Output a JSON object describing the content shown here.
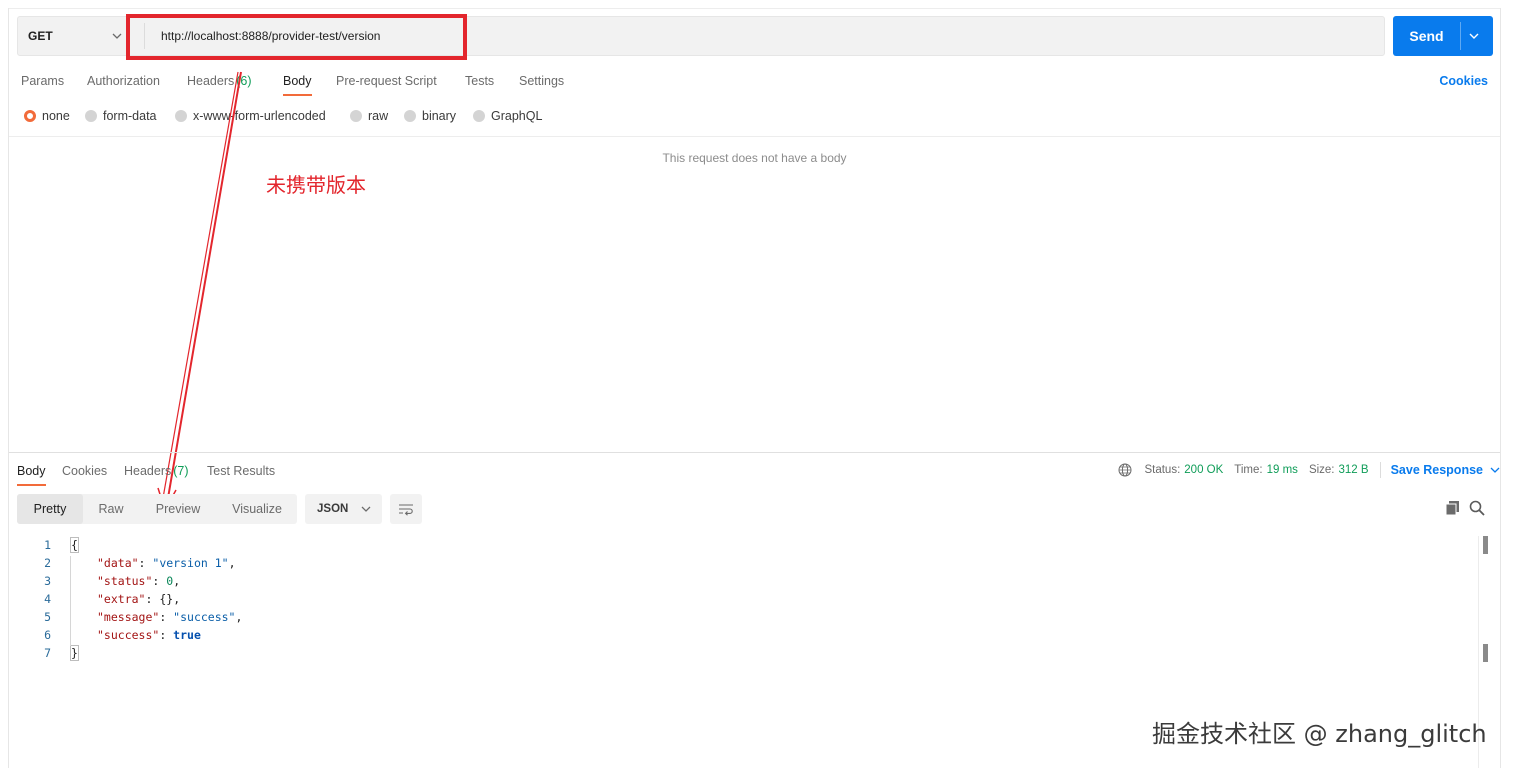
{
  "request": {
    "method": "GET",
    "url": "http://localhost:8888/provider-test/version",
    "send_label": "Send"
  },
  "request_tabs": [
    {
      "label": "Params"
    },
    {
      "label": "Authorization"
    },
    {
      "label": "Headers",
      "count": "(6)"
    },
    {
      "label": "Body",
      "active": true
    },
    {
      "label": "Pre-request Script"
    },
    {
      "label": "Tests"
    },
    {
      "label": "Settings"
    }
  ],
  "cookies_label": "Cookies",
  "body_types": [
    {
      "label": "none",
      "selected": true
    },
    {
      "label": "form-data"
    },
    {
      "label": "x-www-form-urlencoded"
    },
    {
      "label": "raw"
    },
    {
      "label": "binary"
    },
    {
      "label": "GraphQL"
    }
  ],
  "empty_body_message": "This request does not have a body",
  "annotation": {
    "text": "未携带版本",
    "color": "#e3262d"
  },
  "response_tabs": [
    {
      "label": "Body",
      "active": true
    },
    {
      "label": "Cookies"
    },
    {
      "label": "Headers",
      "count": "(7)"
    },
    {
      "label": "Test Results"
    }
  ],
  "response_meta": {
    "status_label": "Status:",
    "status_value": "200 OK",
    "time_label": "Time:",
    "time_value": "19 ms",
    "size_label": "Size:",
    "size_value": "312 B",
    "save_label": "Save Response"
  },
  "view_modes": [
    {
      "label": "Pretty",
      "active": true
    },
    {
      "label": "Raw"
    },
    {
      "label": "Preview"
    },
    {
      "label": "Visualize"
    }
  ],
  "language": "JSON",
  "code_lines": [
    {
      "n": "1",
      "text": "{"
    },
    {
      "n": "2",
      "key": "\"data\"",
      "value": "\"version 1\"",
      "vtype": "s",
      "trail": ","
    },
    {
      "n": "3",
      "key": "\"status\"",
      "value": "0",
      "vtype": "n",
      "trail": ","
    },
    {
      "n": "4",
      "key": "\"extra\"",
      "value": "{}",
      "vtype": "p",
      "trail": ","
    },
    {
      "n": "5",
      "key": "\"message\"",
      "value": "\"success\"",
      "vtype": "s",
      "trail": ","
    },
    {
      "n": "6",
      "key": "\"success\"",
      "value": "true",
      "vtype": "b",
      "trail": ""
    },
    {
      "n": "7",
      "text": "}"
    }
  ],
  "watermark": "掘金技术社区 @ zhang_glitch",
  "colors": {
    "accent_orange": "#f26b3a",
    "send_blue": "#097bed",
    "status_green": "#0f9d58",
    "highlight_red": "#e3262d"
  }
}
